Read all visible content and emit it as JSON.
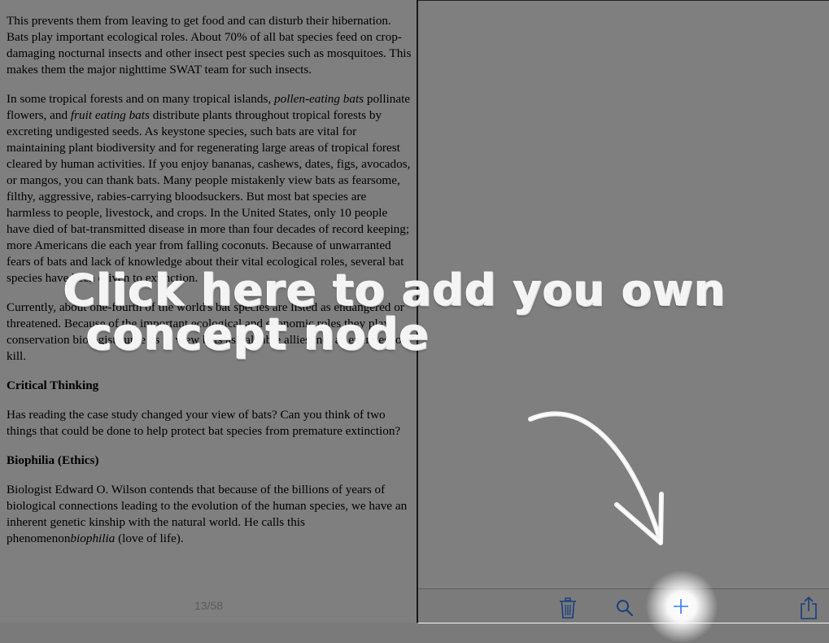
{
  "reader": {
    "paragraphs": {
      "p1": "This prevents them from leaving to get food and can disturb their hibernation. Bats play important ecological roles. About 70% of all bat species feed on crop-damaging nocturnal insects and other insect pest species such as mosquitoes. This makes them the major nighttime SWAT team for such insects.",
      "p2_a": "In some tropical forests and on many tropical islands, ",
      "p2_em1": "pollen-eating bats",
      "p2_b": " pollinate flowers, and ",
      "p2_em2": "fruit eating bats",
      "p2_c": " distribute plants throughout tropical forests by excreting undigested seeds. As keystone species, such bats are vital for maintaining plant biodiversity and for regenerating large areas of tropical forest cleared by human activities. If you enjoy bananas, cashews, dates, figs, avocados, or mangos, you can thank bats. Many people mistakenly view bats as fearsome, filthy, aggressive, rabies-carrying bloodsuckers. But most bat species are harmless to people, livestock, and crops. In the United States, only 10 people have died of bat-transmitted disease in more than four decades of record keeping; more Americans die each year from falling coconuts. Because of unwarranted fears of bats and lack of knowledge about their vital ecological roles, several bat species have been driven to extinction.",
      "p3": "Currently, about one-fourth of the world's bat species are listed as endangered or threatened. Because of the important ecological and economic roles they play, conservation biologists urge us to view bats as valuable allies, not as enemies to kill.",
      "h_critical": "Critical Thinking",
      "p4": "Has reading the case study changed your view of bats? Can you think of two things that could be done to help protect bat species from premature extinction?",
      "h_biophilia": "Biophilia (Ethics)",
      "p5_a": "Biologist Edward O. Wilson contends that because of the billions of years of biological connections leading to the evolution of the human species, we have an inherent genetic kinship with the natural world. He calls this phenomenon",
      "p5_em": "biophilia",
      "p5_b": " (love of life)."
    },
    "page_counter": "13/58"
  },
  "coach": {
    "line1": "Click here to add you own",
    "line2": "concept node"
  },
  "toolbar": {
    "icons": [
      "trash-icon",
      "search-icon",
      "plus-icon",
      "share-icon"
    ],
    "accent": "#2f7cf6"
  }
}
